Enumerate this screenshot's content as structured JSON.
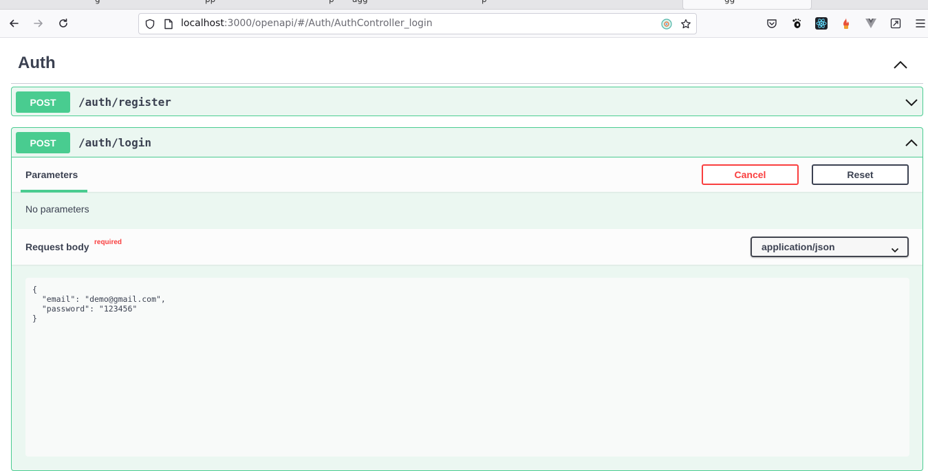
{
  "browser": {
    "tabs": [
      {
        "title": "g"
      },
      {
        "title": "pp"
      },
      {
        "title": "p"
      },
      {
        "title": "agg"
      },
      {
        "title": "p"
      },
      {
        "title": "gg"
      }
    ],
    "url": {
      "host": "localhost",
      "path": ":3000/openapi/#/Auth/AuthController_login"
    },
    "icons": [
      "back-arrow-icon",
      "forward-arrow-icon",
      "reload-icon",
      "shield-icon",
      "page-icon",
      "reader-mode-icon",
      "star-icon",
      "pocket-icon",
      "gnome-extension-icon",
      "react-devtools-icon",
      "extension-fire-icon",
      "vue-devtools-icon",
      "fullscreen-icon",
      "menu-icon"
    ]
  },
  "tag": {
    "title": "Auth"
  },
  "operations": [
    {
      "method": "POST",
      "path": "/auth/register",
      "method_color": "#49cc90"
    },
    {
      "method": "POST",
      "path": "/auth/login",
      "method_color": "#49cc90",
      "parameters_tab": "Parameters",
      "cancel_label": "Cancel",
      "reset_label": "Reset",
      "no_parameters": "No parameters",
      "request_body_label": "Request body",
      "required_label": "required",
      "content_type": "application/json",
      "body": "{\n  \"email\": \"demo@gmail.com\",\n  \"password\": \"123456\"\n}"
    }
  ],
  "colors": {
    "post_green": "#49cc90",
    "cancel_red": "#f93e3e",
    "text": "#3b4151"
  }
}
